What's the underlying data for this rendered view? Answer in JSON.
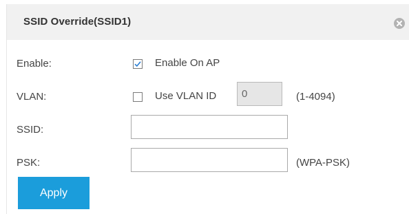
{
  "dialog": {
    "title": "SSID Override(SSID1)",
    "close_icon": "close-icon"
  },
  "form": {
    "enable": {
      "label": "Enable:",
      "checkbox_label": "Enable On AP",
      "checked": true
    },
    "vlan": {
      "label": "VLAN:",
      "checkbox_label": "Use VLAN ID",
      "checked": false,
      "value": "0",
      "range_hint": "(1-4094)"
    },
    "ssid": {
      "label": "SSID:",
      "value": ""
    },
    "psk": {
      "label": "PSK:",
      "value": "",
      "hint": "(WPA-PSK)"
    }
  },
  "actions": {
    "apply_label": "Apply"
  },
  "colors": {
    "accent": "#1b9ddb",
    "header_bg": "#f1f1f1"
  }
}
